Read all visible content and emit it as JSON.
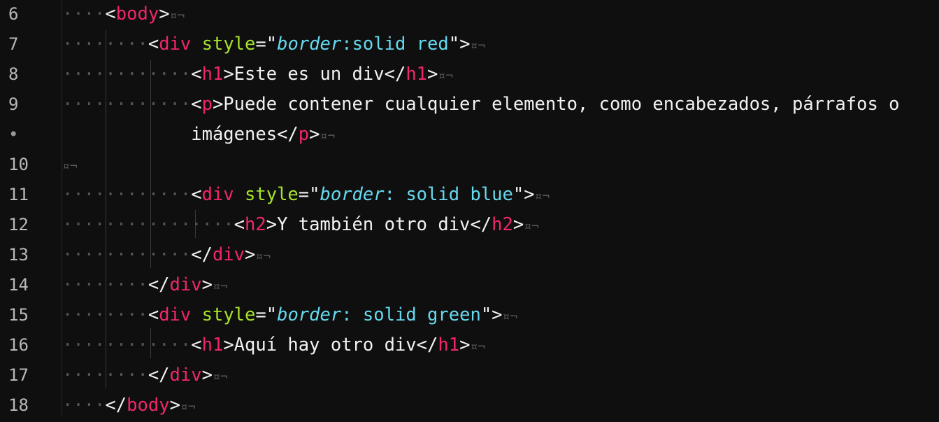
{
  "editor": {
    "line_numbers": [
      "6",
      "7",
      "8",
      "9",
      "•",
      "10",
      "11",
      "12",
      "13",
      "14",
      "15",
      "16",
      "17",
      "18"
    ],
    "eol_marker": "¤¬",
    "lines": [
      {
        "indent": "····",
        "parts": [
          {
            "t": "<",
            "c": "punct"
          },
          {
            "t": "body",
            "c": "tag"
          },
          {
            "t": ">",
            "c": "punct"
          }
        ]
      },
      {
        "indent": "········",
        "parts": [
          {
            "t": "<",
            "c": "punct"
          },
          {
            "t": "div",
            "c": "tag"
          },
          {
            "t": " ",
            "c": "punct"
          },
          {
            "t": "style",
            "c": "attr"
          },
          {
            "t": "=\"",
            "c": "punct"
          },
          {
            "t": "border",
            "c": "kw"
          },
          {
            "t": ":solid red",
            "c": "val"
          },
          {
            "t": "\">",
            "c": "punct"
          }
        ]
      },
      {
        "indent": "············",
        "parts": [
          {
            "t": "<",
            "c": "punct"
          },
          {
            "t": "h1",
            "c": "tag"
          },
          {
            "t": ">Este es un div</",
            "c": "punct"
          },
          {
            "t": "h1",
            "c": "tag"
          },
          {
            "t": ">",
            "c": "punct"
          }
        ]
      },
      {
        "indent": "············",
        "parts": [
          {
            "t": "<",
            "c": "punct"
          },
          {
            "t": "p",
            "c": "tag"
          },
          {
            "t": ">Puede contener cualquier elemento, como encabezados, párrafos o",
            "c": "punct"
          }
        ],
        "noeol": true
      },
      {
        "indent": "            ",
        "parts": [
          {
            "t": "imágenes</",
            "c": "punct"
          },
          {
            "t": "p",
            "c": "tag"
          },
          {
            "t": ">",
            "c": "punct"
          }
        ]
      },
      {
        "indent": "",
        "parts": []
      },
      {
        "indent": "············",
        "parts": [
          {
            "t": "<",
            "c": "punct"
          },
          {
            "t": "div",
            "c": "tag"
          },
          {
            "t": " ",
            "c": "punct"
          },
          {
            "t": "style",
            "c": "attr"
          },
          {
            "t": "=\"",
            "c": "punct"
          },
          {
            "t": "border",
            "c": "kw"
          },
          {
            "t": ": solid blue",
            "c": "val"
          },
          {
            "t": "\">",
            "c": "punct"
          }
        ]
      },
      {
        "indent": "················",
        "parts": [
          {
            "t": "<",
            "c": "punct"
          },
          {
            "t": "h2",
            "c": "tag"
          },
          {
            "t": ">Y también otro div</",
            "c": "punct"
          },
          {
            "t": "h2",
            "c": "tag"
          },
          {
            "t": ">",
            "c": "punct"
          }
        ]
      },
      {
        "indent": "············",
        "parts": [
          {
            "t": "</",
            "c": "punct"
          },
          {
            "t": "div",
            "c": "tag"
          },
          {
            "t": ">",
            "c": "punct"
          }
        ]
      },
      {
        "indent": "········",
        "parts": [
          {
            "t": "</",
            "c": "punct"
          },
          {
            "t": "div",
            "c": "tag"
          },
          {
            "t": ">",
            "c": "punct"
          }
        ]
      },
      {
        "indent": "········",
        "parts": [
          {
            "t": "<",
            "c": "punct"
          },
          {
            "t": "div",
            "c": "tag"
          },
          {
            "t": " ",
            "c": "punct"
          },
          {
            "t": "style",
            "c": "attr"
          },
          {
            "t": "=\"",
            "c": "punct"
          },
          {
            "t": "border",
            "c": "kw"
          },
          {
            "t": ": solid green",
            "c": "val"
          },
          {
            "t": "\">",
            "c": "punct"
          }
        ]
      },
      {
        "indent": "············",
        "parts": [
          {
            "t": "<",
            "c": "punct"
          },
          {
            "t": "h1",
            "c": "tag"
          },
          {
            "t": ">Aquí hay otro div</",
            "c": "punct"
          },
          {
            "t": "h1",
            "c": "tag"
          },
          {
            "t": ">",
            "c": "punct"
          }
        ]
      },
      {
        "indent": "········",
        "parts": [
          {
            "t": "</",
            "c": "punct"
          },
          {
            "t": "div",
            "c": "tag"
          },
          {
            "t": ">",
            "c": "punct"
          }
        ]
      },
      {
        "indent": "····",
        "parts": [
          {
            "t": "</",
            "c": "punct"
          },
          {
            "t": "body",
            "c": "tag"
          },
          {
            "t": ">",
            "c": "punct"
          }
        ]
      }
    ]
  },
  "colors": {
    "background": "#0f0f0f",
    "tag": "#f1266b",
    "attribute": "#a6e22e",
    "value": "#66d9ef",
    "text": "#f2f2f2",
    "whitespace": "#555555"
  }
}
